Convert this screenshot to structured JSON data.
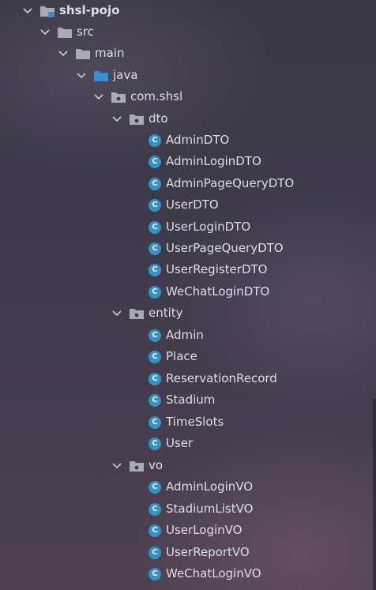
{
  "tree": {
    "module": {
      "label": "shsl-pojo",
      "icon": "module-folder-icon"
    },
    "src": {
      "label": "src",
      "icon": "folder-icon"
    },
    "main": {
      "label": "main",
      "icon": "folder-icon"
    },
    "java": {
      "label": "java",
      "icon": "source-root-folder-icon",
      "color": "#3a8fd1"
    },
    "package_root": {
      "label": "com.shsl",
      "icon": "package-icon"
    },
    "dto": {
      "label": "dto",
      "icon": "package-icon",
      "classes": [
        "AdminDTO",
        "AdminLoginDTO",
        "AdminPageQueryDTO",
        "UserDTO",
        "UserLoginDTO",
        "UserPageQueryDTO",
        "UserRegisterDTO",
        "WeChatLoginDTO"
      ]
    },
    "entity": {
      "label": "entity",
      "icon": "package-icon",
      "classes": [
        "Admin",
        "Place",
        "ReservationRecord",
        "Stadium",
        "TimeSlots",
        "User"
      ]
    },
    "vo": {
      "label": "vo",
      "icon": "package-icon",
      "classes": [
        "AdminLoginVO",
        "StadiumListVO",
        "UserLoginVO",
        "UserReportVO",
        "WeChatLoginVO"
      ]
    },
    "class_icon_letter": "C",
    "class_icon_color": "#3592c4"
  }
}
